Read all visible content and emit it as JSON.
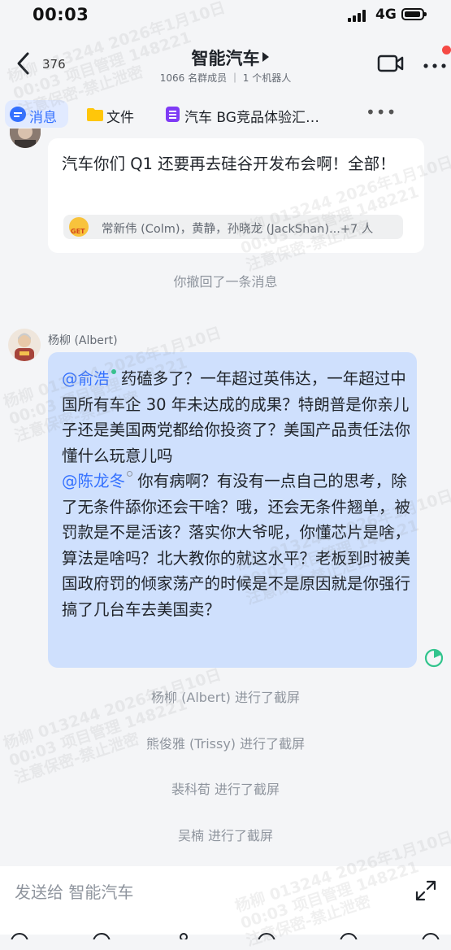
{
  "status_bar": {
    "time": "00:03",
    "network": "4G"
  },
  "header": {
    "back_count": "376",
    "title": "智能汽车",
    "subtitle": "1066 名群成员 ｜ 1 个机器人"
  },
  "tabs": [
    {
      "label": "消息",
      "icon": "chat-bubble-icon",
      "active": true
    },
    {
      "label": "文件",
      "icon": "folder-icon"
    },
    {
      "label": "汽车 BG竞品体验汇…",
      "icon": "doc-list-icon"
    }
  ],
  "messages": {
    "first": {
      "text": "汽车你们 Q1 还要再去硅谷开发布会啊！全部！",
      "reaction_emoji": "GET",
      "reaction_users": "常新伟 (Colm)，黄静，孙晓龙 (JackShan)...+7 人"
    },
    "recall_notice": "你撤回了一条消息",
    "albert": {
      "sender": "杨柳 (Albert)",
      "mention_1": "@俞浩",
      "text_1": " 药磕多了？一年超过英伟达，一年超过中国所有车企 30 年未达成的成果？特朗普是你亲儿子还是美国两党都给你投资了？美国产品责任法你懂什么玩意儿吗",
      "mention_2": "@陈龙冬",
      "text_2": " 你有病啊？有没有一点自己的思考，除了无条件舔你还会干啥？哦，还会无条件翘单，被罚款是不是活该？落实你大爷呢，你懂芯片是啥，算法是啥吗？北大教你的就这水平？老板到时被美国政府罚的倾家荡产的时候是不是原因就是你强行搞了几台车去美国卖？"
    },
    "screenshot_notices": [
      "杨柳 (Albert) 进行了截屏",
      "熊俊雅 (Trissy) 进行了截屏",
      "裴科荀 进行了截屏",
      "吴楠 进行了截屏"
    ]
  },
  "input": {
    "placeholder": "发送给 智能汽车"
  },
  "watermark": {
    "line1": "杨柳 013244 2026年1月10日",
    "line2": "00:03 项目管理 148221",
    "line3": "注意保密-禁止泄密"
  },
  "colors": {
    "accent": "#3370ff",
    "bubble_self": "#cfe0fd",
    "read_indicator": "#32c48d",
    "notification": "#f54a45"
  }
}
